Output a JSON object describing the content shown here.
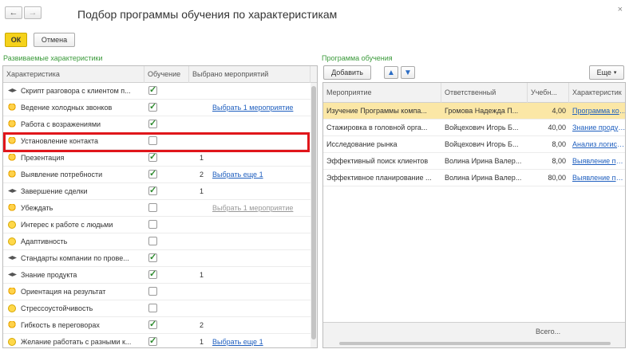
{
  "window": {
    "title": "Подбор программы обучения по характеристикам",
    "close_icon": "×"
  },
  "nav": {
    "back": "←",
    "forward": "→"
  },
  "toolbar": {
    "ok_label": "ОК",
    "cancel_label": "Отмена"
  },
  "left": {
    "section_title": "Развиваемые характеристики",
    "columns": [
      "Характеристика",
      "Обучение",
      "Выбрано мероприятий"
    ],
    "rows": [
      {
        "icon": "cap",
        "name": "Скрипт разговора с клиентом п...",
        "checked": true,
        "count": "",
        "link": "",
        "link_disabled": false
      },
      {
        "icon": "bulb",
        "name": "Ведение холодных звонков",
        "checked": true,
        "count": "",
        "link": "Выбрать 1 мероприятие",
        "link_disabled": false
      },
      {
        "icon": "bulb",
        "name": "Работа с возражениями",
        "checked": true,
        "count": "",
        "link": "",
        "link_disabled": false
      },
      {
        "icon": "bulb",
        "name": "Установление контакта",
        "checked": false,
        "count": "",
        "link": "",
        "link_disabled": false
      },
      {
        "icon": "bulb",
        "name": "Презентация",
        "checked": true,
        "count": "1",
        "link": "",
        "link_disabled": false
      },
      {
        "icon": "bulb",
        "name": "Выявление потребности",
        "checked": true,
        "count": "2",
        "link": "Выбрать еще 1",
        "link_disabled": false
      },
      {
        "icon": "cap",
        "name": "Завершение сделки",
        "checked": true,
        "count": "1",
        "link": "",
        "link_disabled": false
      },
      {
        "icon": "bulb",
        "name": "Убеждать",
        "checked": false,
        "count": "",
        "link": "Выбрать 1 мероприятие",
        "link_disabled": true
      },
      {
        "icon": "smile",
        "name": "Интерес к работе с людьми",
        "checked": false,
        "count": "",
        "link": "",
        "link_disabled": false
      },
      {
        "icon": "smile",
        "name": "Адаптивность",
        "checked": false,
        "count": "",
        "link": "",
        "link_disabled": false
      },
      {
        "icon": "cap",
        "name": "Стандарты компании по прове...",
        "checked": true,
        "count": "",
        "link": "",
        "link_disabled": false
      },
      {
        "icon": "cap",
        "name": "Знание продукта",
        "checked": true,
        "count": "1",
        "link": "",
        "link_disabled": false
      },
      {
        "icon": "bulb",
        "name": "Ориентация на результат",
        "checked": false,
        "count": "",
        "link": "",
        "link_disabled": false
      },
      {
        "icon": "smile",
        "name": "Стрессоустойчивость",
        "checked": false,
        "count": "",
        "link": "",
        "link_disabled": false
      },
      {
        "icon": "bulb",
        "name": "Гибкость в переговорах",
        "checked": true,
        "count": "2",
        "link": "",
        "link_disabled": false
      },
      {
        "icon": "smile",
        "name": "Желание работать с разными к...",
        "checked": true,
        "count": "1",
        "link": "Выбрать еще 1",
        "link_disabled": false
      }
    ]
  },
  "right": {
    "section_title": "Программа обучения",
    "add_label": "Добавить",
    "more_label": "Еще",
    "columns": [
      "Мероприятие",
      "Ответственный",
      "Учебн...",
      "Характеристик"
    ],
    "rows": [
      {
        "event": "Изучение Программы компа...",
        "resp": "Громова Надежда П...",
        "hours": "4,00",
        "char": "Программа компа"
      },
      {
        "event": "Стажировка в головной орга...",
        "resp": "Войцехович Игорь Б...",
        "hours": "40,00",
        "char": "Знание продукта"
      },
      {
        "event": "Исследование рынка",
        "resp": "Войцехович Игорь Б...",
        "hours": "8,00",
        "char": "Анализ логистич"
      },
      {
        "event": "Эффективный поиск клиентов",
        "resp": "Волина Ирина Валер...",
        "hours": "8,00",
        "char": "Выявление потре"
      },
      {
        "event": "Эффективное планирование ...",
        "resp": "Волина Ирина Валер...",
        "hours": "80,00",
        "char": "Выявление потре"
      }
    ],
    "footer_total": "Всего..."
  }
}
